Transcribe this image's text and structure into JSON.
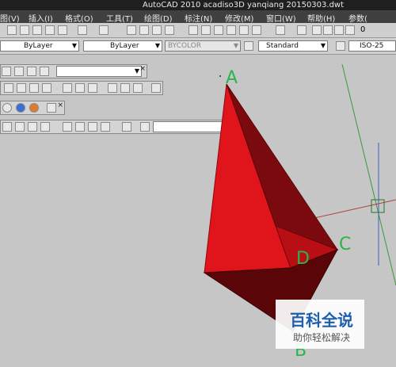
{
  "titlebar": {
    "title": "AutoCAD 2010    acadiso3D  yanqiang 20150303.dwt"
  },
  "menu": [
    "图(V)",
    "插入(I)",
    "格式(O)",
    "工具(T)",
    "绘图(D)",
    "标注(N)",
    "修改(M)",
    "窗口(W)",
    "帮助(H)",
    "参数("
  ],
  "properties": {
    "layer_color": "ByLayer",
    "linetype": "ByLayer",
    "plotstyle": "BYCOLOR",
    "text_style": "Standard",
    "dim_style": "ISO-25",
    "layer_value": "0"
  },
  "canvas": {
    "labels": {
      "a": "A",
      "b": "B",
      "c": "C",
      "d": "D"
    },
    "colors": {
      "face_front": "#e0141b",
      "face_side": "#7a0a0e",
      "face_bottom": "#5a0508",
      "face_right": "#b80f14",
      "label": "#2bb34c"
    }
  },
  "watermark": {
    "main": "百科全说",
    "sub": "助你轻松解决"
  }
}
